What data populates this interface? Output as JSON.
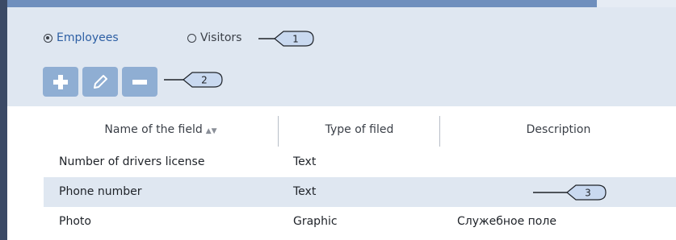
{
  "radio": {
    "employees_label": "Employees",
    "visitors_label": "Visitors",
    "selected": "Employees"
  },
  "toolbar": {
    "add_icon": "plus-icon",
    "edit_icon": "pencil-icon",
    "delete_icon": "minus-icon"
  },
  "callouts": {
    "c1": "1",
    "c2": "2",
    "c3": "3"
  },
  "table": {
    "headers": {
      "name": "Name of the field",
      "type": "Type of filed",
      "description": "Description"
    },
    "sort_icon": "sort-icon",
    "rows": [
      {
        "name": "Number of drivers license",
        "type": "Text",
        "description": ""
      },
      {
        "name": "Phone number",
        "type": "Text",
        "description": ""
      },
      {
        "name": "Photo",
        "type": "Graphic",
        "description": "Служебное поле"
      }
    ]
  },
  "colors": {
    "panel_bg": "#dfe7f1",
    "button_bg": "#8faed3",
    "accent_blue": "#2d5fa4",
    "callout_fill": "#c9d9f0",
    "left_border": "#3b4a66"
  }
}
